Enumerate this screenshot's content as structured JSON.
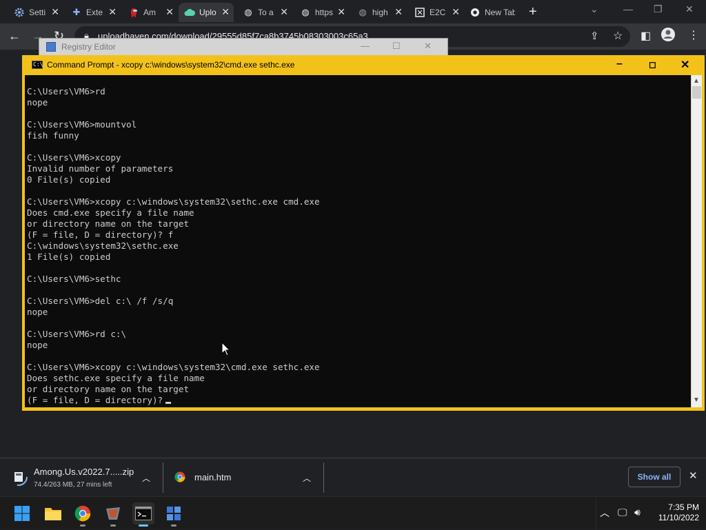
{
  "browser": {
    "tabs": [
      {
        "label": "Setti",
        "icon": "gear-icon",
        "active": false
      },
      {
        "label": "Exte",
        "icon": "puzzle-icon",
        "active": false
      },
      {
        "label": "Am",
        "icon": "among-us-icon",
        "active": false
      },
      {
        "label": "Uplo",
        "icon": "cloud-upload-icon",
        "active": true
      },
      {
        "label": "To a",
        "icon": "globe-icon",
        "active": false
      },
      {
        "label": "https",
        "icon": "globe-icon",
        "active": false
      },
      {
        "label": "high",
        "icon": "globe-icon",
        "active": false
      },
      {
        "label": "E2C",
        "icon": "e2c-icon",
        "active": false
      },
      {
        "label": "New Tab",
        "icon": "chrome-icon",
        "active": false
      }
    ],
    "url": "uploadhaven.com/download/29555d85f7ca8b3745b08303003c65a3"
  },
  "regedit": {
    "title": "Registry Editor"
  },
  "cmd": {
    "title": "Command Prompt - xcopy  c:\\windows\\system32\\cmd.exe sethc.exe",
    "output": "C:\\Users\\VM6>rd\nnope\n\nC:\\Users\\VM6>mountvol\nfish funny\n\nC:\\Users\\VM6>xcopy\nInvalid number of parameters\n0 File(s) copied\n\nC:\\Users\\VM6>xcopy c:\\windows\\system32\\sethc.exe cmd.exe\nDoes cmd.exe specify a file name\nor directory name on the target\n(F = file, D = directory)? f\nC:\\windows\\system32\\sethc.exe\n1 File(s) copied\n\nC:\\Users\\VM6>sethc\n\nC:\\Users\\VM6>del c:\\ /f /s/q\nnope\n\nC:\\Users\\VM6>rd c:\\\nnope\n\nC:\\Users\\VM6>xcopy c:\\windows\\system32\\cmd.exe sethc.exe\nDoes sethc.exe specify a file name\nor directory name on the target\n(F = file, D = directory)?"
  },
  "downloads": {
    "items": [
      {
        "name": "Among.Us.v2022.7.....zip",
        "status": "74.4/263 MB, 27 mins left"
      },
      {
        "name": "main.htm",
        "status": ""
      }
    ],
    "show_all": "Show all"
  },
  "taskbar": {
    "time": "7:35 PM",
    "date": "11/10/2022"
  },
  "colors": {
    "cmd_border": "#f3c21a",
    "console_bg": "#0c0c0c",
    "console_text": "#cccccc",
    "link_blue": "#8ab4f8"
  }
}
